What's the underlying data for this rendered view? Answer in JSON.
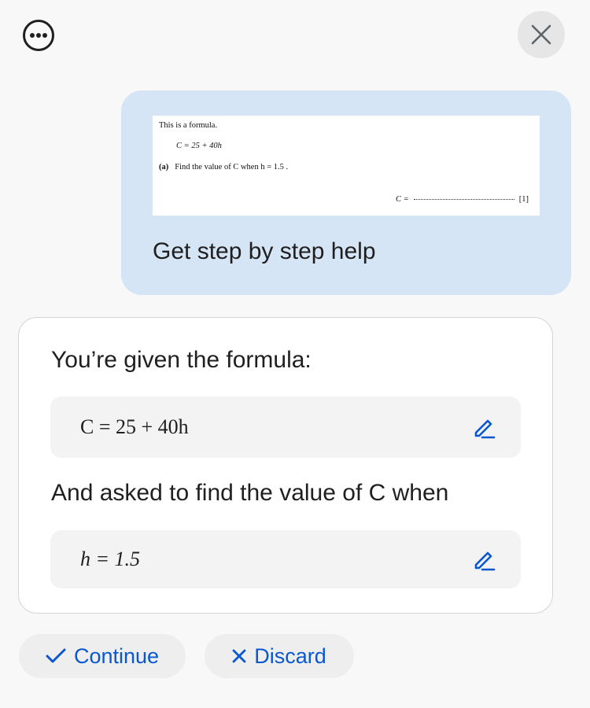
{
  "colors": {
    "accent": "#0b57d0",
    "bubble_bg": "#d6e5f6",
    "page_bg": "#f8f8f8"
  },
  "header": {
    "more_icon": "more-horizontal-icon",
    "close_icon": "close-icon"
  },
  "user_message": {
    "snapshot": {
      "line1": "This is a formula.",
      "formula": "C = 25 + 40h",
      "part_label": "(a)",
      "question": "Find the value of C when h = 1.5 .",
      "answer_label": "C =",
      "marks": "[1]"
    },
    "prompt": "Get step by step help"
  },
  "response": {
    "intro": "You’re given the formula:",
    "formula": "C = 25 + 40h",
    "followup": "And asked to find the value of C when",
    "condition": "h = 1.5",
    "edit_icon": "pencil-icon"
  },
  "actions": {
    "continue_label": "Continue",
    "continue_icon": "check-icon",
    "discard_label": "Discard",
    "discard_icon": "x-icon"
  }
}
